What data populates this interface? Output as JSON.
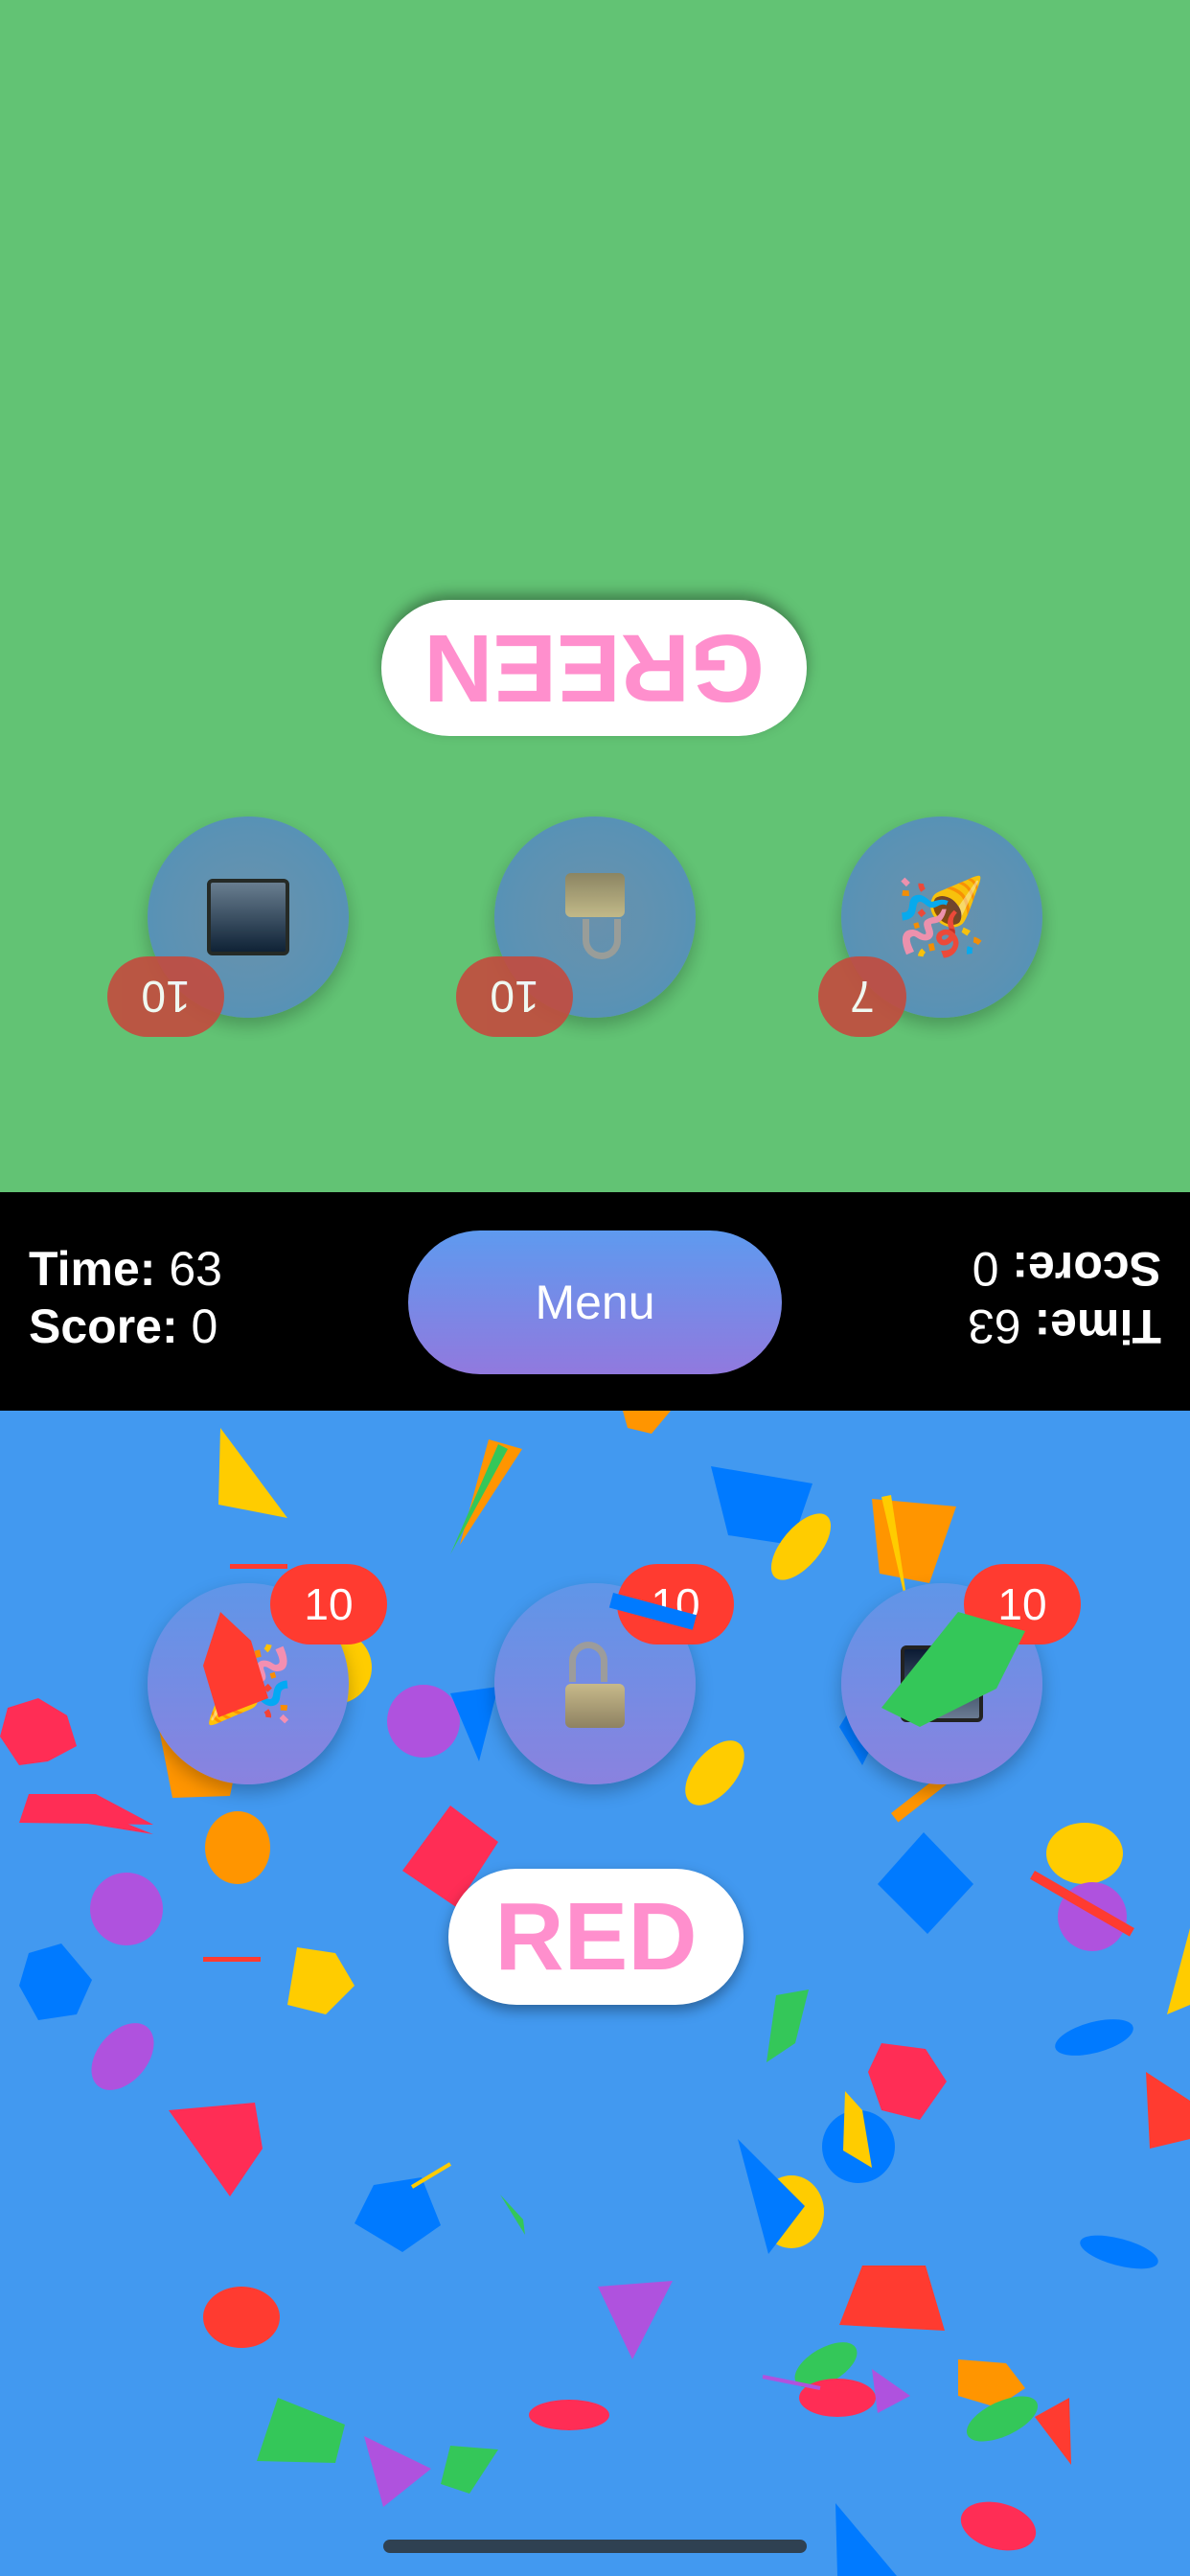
{
  "top_player": {
    "word": "GREEN",
    "powerups": [
      {
        "icon": "screen-blank-icon",
        "count": "10"
      },
      {
        "icon": "padlock-icon",
        "count": "10"
      },
      {
        "icon": "party-popper-icon",
        "count": "7"
      }
    ],
    "time_label": "Time:",
    "time_value": "63",
    "score_label": "Score:",
    "score_value": "0"
  },
  "bottom_player": {
    "word": "RED",
    "powerups": [
      {
        "icon": "party-popper-icon",
        "count": "10"
      },
      {
        "icon": "padlock-icon",
        "count": "10"
      },
      {
        "icon": "screen-blank-icon",
        "count": "10"
      }
    ],
    "time_label": "Time:",
    "time_value": "63",
    "score_label": "Score:",
    "score_value": "0"
  },
  "menu_label": "Menu",
  "colors": {
    "top_background": "#62c374",
    "bottom_background": "#4299f0",
    "word_color": "#ff8fcd",
    "badge": "#ff3b30"
  }
}
